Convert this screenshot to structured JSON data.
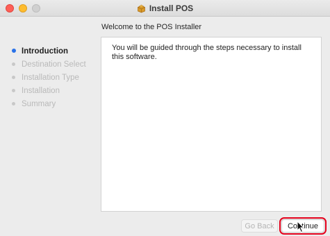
{
  "window": {
    "title": "Install POS",
    "icon": "package-icon"
  },
  "header": {
    "subtitle": "Welcome to the POS Installer"
  },
  "sidebar": {
    "steps": [
      {
        "label": "Introduction",
        "active": true
      },
      {
        "label": "Destination Select",
        "active": false
      },
      {
        "label": "Installation Type",
        "active": false
      },
      {
        "label": "Installation",
        "active": false
      },
      {
        "label": "Summary",
        "active": false
      }
    ]
  },
  "main": {
    "message": "You will be guided through the steps necessary to install this software."
  },
  "buttons": {
    "back_label": "Go Back",
    "continue_label": "Continue"
  },
  "colors": {
    "active_step": "#2a72e8",
    "highlight": "#e3001b"
  }
}
